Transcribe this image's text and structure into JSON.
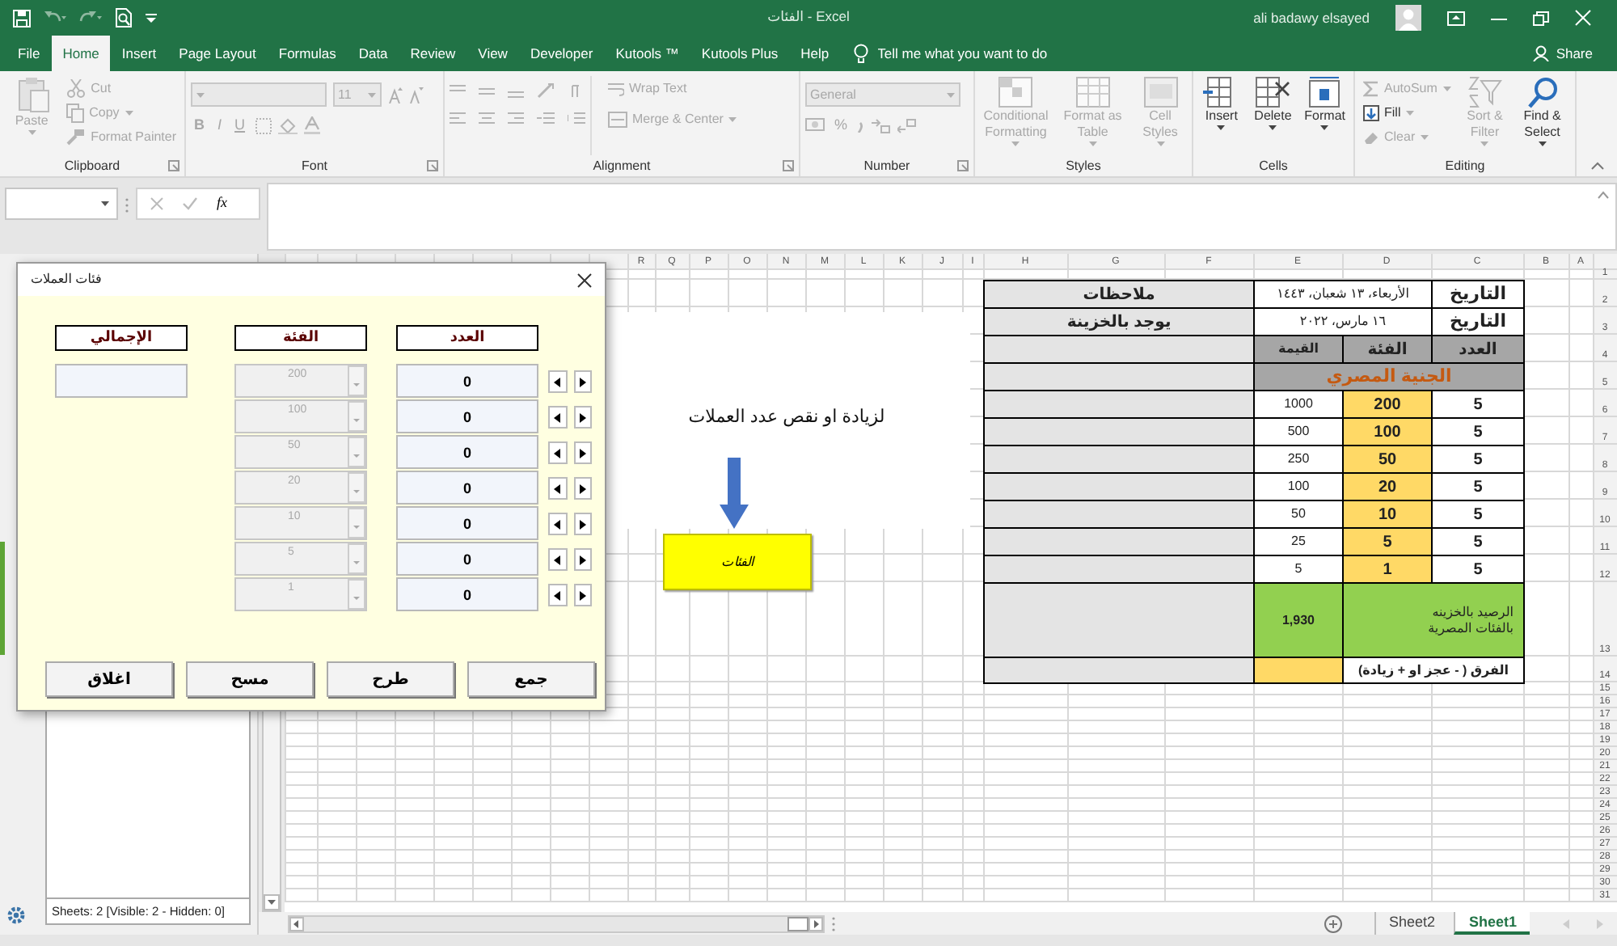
{
  "window": {
    "title": "الفئات - Excel",
    "user": "ali badawy elsayed"
  },
  "ribbon_tabs": [
    {
      "label": "File",
      "selected": false
    },
    {
      "label": "Home",
      "selected": true
    },
    {
      "label": "Insert",
      "selected": false
    },
    {
      "label": "Page Layout",
      "selected": false
    },
    {
      "label": "Formulas",
      "selected": false
    },
    {
      "label": "Data",
      "selected": false
    },
    {
      "label": "Review",
      "selected": false
    },
    {
      "label": "View",
      "selected": false
    },
    {
      "label": "Developer",
      "selected": false
    },
    {
      "label": "Kutools ™",
      "selected": false
    },
    {
      "label": "Kutools Plus",
      "selected": false
    },
    {
      "label": "Help",
      "selected": false
    }
  ],
  "tell_me": {
    "placeholder": "Tell me what you want to do"
  },
  "share": "Share",
  "ribbon_groups": [
    {
      "kind": "clipboard",
      "label": "Clipboard",
      "items": [
        {
          "label": "Paste",
          "disabled": true
        },
        {
          "label": "Cut",
          "disabled": true
        },
        {
          "label": "Copy",
          "disabled": true
        },
        {
          "label": "Format Painter",
          "disabled": true
        }
      ]
    },
    {
      "kind": "font",
      "label": "Font",
      "font_size": "11",
      "items": [
        {
          "label": "B",
          "disabled": true
        },
        {
          "label": "I",
          "disabled": true
        },
        {
          "label": "U",
          "disabled": true
        }
      ]
    },
    {
      "kind": "alignment",
      "label": "Alignment",
      "items": [
        {
          "label": "Wrap Text",
          "disabled": true
        },
        {
          "label": "Merge & Center",
          "disabled": true
        }
      ]
    },
    {
      "kind": "number",
      "label": "Number",
      "format": "General",
      "items": [
        {
          "label": "%",
          "disabled": true
        }
      ]
    },
    {
      "kind": "styles",
      "label": "Styles",
      "items": [
        {
          "label": "Conditional Formatting",
          "disabled": true
        },
        {
          "label": "Format as Table",
          "disabled": true
        },
        {
          "label": "Cell Styles",
          "disabled": true
        }
      ]
    },
    {
      "kind": "cells",
      "label": "Cells",
      "items": [
        {
          "label": "Insert",
          "disabled": false
        },
        {
          "label": "Delete",
          "disabled": false
        },
        {
          "label": "Format",
          "disabled": false
        }
      ]
    },
    {
      "kind": "editing",
      "label": "Editing",
      "items": [
        {
          "label": "AutoSum",
          "disabled": true
        },
        {
          "label": "Fill",
          "disabled": false
        },
        {
          "label": "Clear",
          "disabled": true
        },
        {
          "label": "Sort & Filter",
          "disabled": true
        },
        {
          "label": "Find & Select",
          "disabled": false
        }
      ]
    }
  ],
  "formula_bar": {
    "function_label": "fx"
  },
  "sheet": {
    "column_headers": [
      "R",
      "Q",
      "P",
      "O",
      "N",
      "M",
      "L",
      "K",
      "J",
      "I",
      "H",
      "G",
      "F",
      "E",
      "D",
      "C",
      "B",
      "A"
    ],
    "row_headers": [
      "1",
      "2",
      "3",
      "4",
      "5",
      "6",
      "7",
      "8",
      "9",
      "10",
      "11",
      "12",
      "13",
      "14",
      "15",
      "16",
      "17",
      "18",
      "19",
      "20",
      "21",
      "22",
      "23",
      "24",
      "25",
      "26",
      "27",
      "28",
      "29",
      "30",
      "31"
    ],
    "table": [
      {
        "kind": "date",
        "label": "التاريخ",
        "value": "الأربعاء، ١٣ شعبان، ١٤٤٣",
        "note": "ملاحظات"
      },
      {
        "kind": "date",
        "label": "التاريخ",
        "value": "١٦ مارس، ٢٠٢٢",
        "note": "يوجد بالخزينة"
      },
      {
        "kind": "header",
        "cells": [
          "العدد",
          "الفئة",
          "القيمة"
        ]
      },
      {
        "kind": "currency",
        "label": "الجنية المصري"
      },
      {
        "kind": "denomination",
        "count": "5",
        "denomination": "200",
        "value": "1000"
      },
      {
        "kind": "denomination",
        "count": "5",
        "denomination": "100",
        "value": "500"
      },
      {
        "kind": "denomination",
        "count": "5",
        "denomination": "50",
        "value": "250"
      },
      {
        "kind": "denomination",
        "count": "5",
        "denomination": "20",
        "value": "100"
      },
      {
        "kind": "denomination",
        "count": "5",
        "denomination": "10",
        "value": "50"
      },
      {
        "kind": "denomination",
        "count": "5",
        "denomination": "5",
        "value": "25"
      },
      {
        "kind": "denomination",
        "count": "5",
        "denomination": "1",
        "value": "5"
      },
      {
        "kind": "balance",
        "label": "الرصيد بالخزينه بالفئات المصرية",
        "value": "1,930"
      },
      {
        "kind": "difference",
        "label": "الفرق ( - عجز او + زيادة)"
      }
    ],
    "note_box": {
      "text": "لزيادة او نقص عدد العملات"
    },
    "shape_button": {
      "text": "الفئات"
    }
  },
  "dialog": {
    "title": "فئات العملات",
    "headings": [
      "العدد",
      "الفئة",
      "الإجمالي"
    ],
    "rows": [
      {
        "denomination": "200",
        "count": "0",
        "disabled": true
      },
      {
        "denomination": "100",
        "count": "0",
        "disabled": true
      },
      {
        "denomination": "50",
        "count": "0",
        "disabled": true
      },
      {
        "denomination": "20",
        "count": "0",
        "disabled": true
      },
      {
        "denomination": "10",
        "count": "0",
        "disabled": true
      },
      {
        "denomination": "5",
        "count": "0",
        "disabled": true
      },
      {
        "denomination": "1",
        "count": "0",
        "disabled": true
      }
    ],
    "buttons": [
      "جمع",
      "طرح",
      "مسح",
      "اغلاق"
    ]
  },
  "sheets_pane": {
    "status": "Sheets: 2  [Visible: 2 - Hidden: 0]"
  },
  "sheet_tabs": [
    {
      "label": "Sheet2",
      "selected": false
    },
    {
      "label": "Sheet1",
      "selected": true
    }
  ]
}
